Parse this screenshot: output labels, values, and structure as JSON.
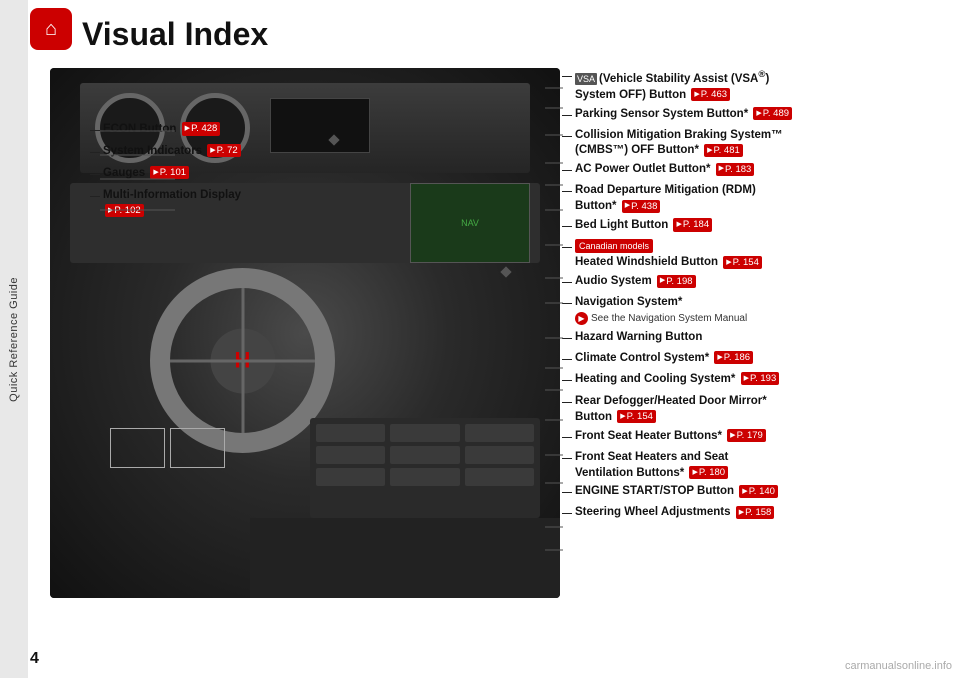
{
  "page": {
    "title": "Visual Index",
    "number": "4",
    "watermark": "carmanualsonline.info"
  },
  "sidebar": {
    "label": "Quick Reference Guide"
  },
  "left_labels": [
    {
      "text": "ECON Button",
      "ref": "P. 428"
    },
    {
      "text": "System Indicators",
      "ref": "P. 72"
    },
    {
      "text": "Gauges",
      "ref": "P. 101"
    },
    {
      "text": "Multi-Information Display",
      "ref": "P. 102",
      "multiline": true
    }
  ],
  "right_labels": [
    {
      "text": "(Vehicle Stability Assist (VSA®) System OFF) Button",
      "ref": "P. 463",
      "has_icon": true,
      "multiline": true
    },
    {
      "text": "Parking Sensor System Button*",
      "ref": "P. 489"
    },
    {
      "text": "Collision Mitigation Braking System™ (CMBS™) OFF Button*",
      "ref": "P. 481",
      "multiline": true
    },
    {
      "text": "AC Power Outlet Button*",
      "ref": "P. 183"
    },
    {
      "text": "Road Departure Mitigation (RDM) Button*",
      "ref": "P. 438",
      "multiline": true
    },
    {
      "text": "Bed Light Button",
      "ref": "P. 184"
    },
    {
      "canadian": true,
      "text": "Heated Windshield Button",
      "ref": "P. 154"
    },
    {
      "text": "Audio System",
      "ref": "P. 198"
    },
    {
      "text": "Navigation System*",
      "nav_note": "See the Navigation System Manual"
    },
    {
      "text": "Hazard Warning Button"
    },
    {
      "text": "Climate Control System*",
      "ref": "P. 186"
    },
    {
      "text": "Heating and Cooling System*",
      "ref": "P. 193"
    },
    {
      "text": "Rear Defogger/Heated Door Mirror* Button",
      "ref": "P. 154",
      "multiline": true
    },
    {
      "text": "Front Seat Heater Buttons*",
      "ref": "P. 179"
    },
    {
      "text": "Front Seat Heaters and Seat Ventilation Buttons*",
      "ref": "P. 180",
      "multiline": true
    },
    {
      "text": "ENGINE START/STOP Button",
      "ref": "P. 140"
    },
    {
      "text": "Steering Wheel Adjustments",
      "ref": "P. 158"
    }
  ]
}
